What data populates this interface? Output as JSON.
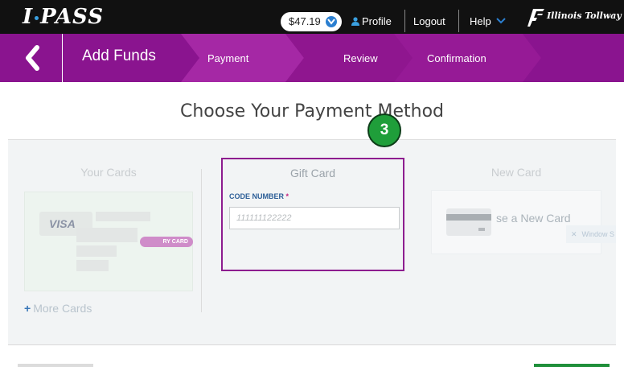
{
  "header": {
    "brand": "I",
    "brand_tail": "PASS",
    "balance": "$47.19",
    "profile_label": "Profile",
    "logout_label": "Logout",
    "help_label": "Help",
    "tollway_label": "Illinois Tollway"
  },
  "nav": {
    "title": "Add Funds",
    "steps": [
      "Payment",
      "Review",
      "Confirmation"
    ]
  },
  "page_title": "Choose Your Payment Method",
  "your_cards": {
    "title": "Your Cards",
    "visa_label": "VISA",
    "primary_badge": "RY CARD",
    "more_cards": "More Cards"
  },
  "gift_card": {
    "title": "Gift Card",
    "code_label": "CODE NUMBER",
    "required_mark": "*",
    "placeholder": "111111122222"
  },
  "new_card": {
    "title": "New Card",
    "use_new": "se a New Card",
    "overlay": "Window S"
  },
  "annotation_step": "3",
  "colors": {
    "nav_purple": "#8a148f",
    "highlight_border": "#8d1d8f",
    "step_badge_green": "#1f9e3a",
    "link_blue": "#2b7fd0"
  }
}
